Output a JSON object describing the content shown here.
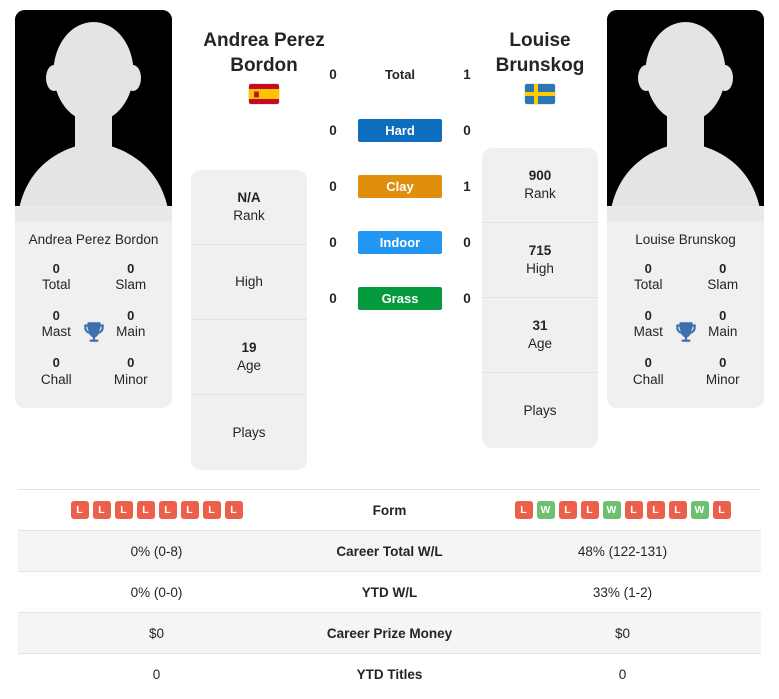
{
  "players": {
    "left": {
      "name": "Andrea Perez Bordon",
      "name_lines": [
        "Andrea Perez",
        "Bordon"
      ],
      "country": "Spain",
      "flag_icon": "flag-spain",
      "avatar_icon": "player-silhouette-avatar",
      "titles": [
        {
          "value": "0",
          "label": "Total"
        },
        {
          "value": "0",
          "label": "Slam"
        },
        {
          "value": "0",
          "label": "Mast"
        },
        {
          "value": "0",
          "label": "Main"
        },
        {
          "value": "0",
          "label": "Chall"
        },
        {
          "value": "0",
          "label": "Minor"
        }
      ],
      "info": [
        {
          "value": "N/A",
          "label": "Rank"
        },
        {
          "value": "",
          "label": "High"
        },
        {
          "value": "19",
          "label": "Age"
        },
        {
          "value": "",
          "label": "Plays"
        }
      ],
      "form": [
        "L",
        "L",
        "L",
        "L",
        "L",
        "L",
        "L",
        "L"
      ],
      "career_total_wl": "0% (0-8)",
      "ytd_wl": "0% (0-0)",
      "career_prize_money": "$0",
      "ytd_titles": "0"
    },
    "right": {
      "name": "Louise Brunskog",
      "name_lines": [
        "Louise",
        "Brunskog"
      ],
      "country": "Sweden",
      "flag_icon": "flag-sweden",
      "avatar_icon": "player-silhouette-avatar",
      "titles": [
        {
          "value": "0",
          "label": "Total"
        },
        {
          "value": "0",
          "label": "Slam"
        },
        {
          "value": "0",
          "label": "Mast"
        },
        {
          "value": "0",
          "label": "Main"
        },
        {
          "value": "0",
          "label": "Chall"
        },
        {
          "value": "0",
          "label": "Minor"
        }
      ],
      "info": [
        {
          "value": "900",
          "label": "Rank"
        },
        {
          "value": "715",
          "label": "High"
        },
        {
          "value": "31",
          "label": "Age"
        },
        {
          "value": "",
          "label": "Plays"
        }
      ],
      "form": [
        "L",
        "W",
        "L",
        "L",
        "W",
        "L",
        "L",
        "L",
        "W",
        "L"
      ],
      "career_total_wl": "48% (122-131)",
      "ytd_wl": "33% (1-2)",
      "career_prize_money": "$0",
      "ytd_titles": "0"
    }
  },
  "head_to_head": {
    "trophy_icon": "trophy-icon",
    "rows": [
      {
        "left": "0",
        "label": "Total",
        "right": "1",
        "type": "total"
      },
      {
        "left": "0",
        "label": "Hard",
        "right": "0",
        "type": "surface",
        "color": "#0d6ebd"
      },
      {
        "left": "0",
        "label": "Clay",
        "right": "1",
        "type": "surface",
        "color": "#e08e0b"
      },
      {
        "left": "0",
        "label": "Indoor",
        "right": "0",
        "type": "surface",
        "color": "#2196f3"
      },
      {
        "left": "0",
        "label": "Grass",
        "right": "0",
        "type": "surface",
        "color": "#049a3d"
      }
    ]
  },
  "stats_table": {
    "rows": [
      {
        "label": "Form",
        "type": "form"
      },
      {
        "label": "Career Total W/L",
        "type": "text",
        "key": "career_total_wl"
      },
      {
        "label": "YTD W/L",
        "type": "text",
        "key": "ytd_wl"
      },
      {
        "label": "Career Prize Money",
        "type": "text",
        "key": "career_prize_money"
      },
      {
        "label": "YTD Titles",
        "type": "text",
        "key": "ytd_titles"
      }
    ]
  },
  "colors": {
    "win_badge": "#6cc070",
    "loss_badge": "#ec5f4a",
    "card_bg": "#f0f0f0",
    "stripe_bg": "#f5f5f5",
    "trophy": "#3e6fad"
  }
}
